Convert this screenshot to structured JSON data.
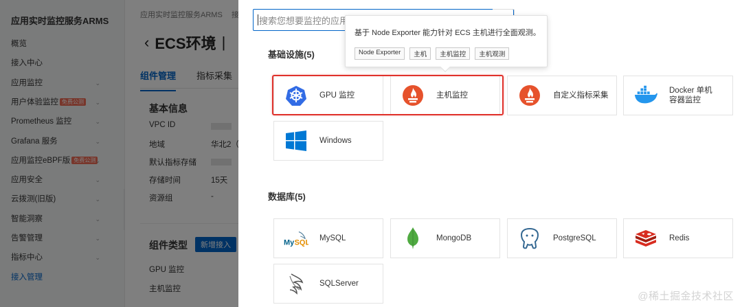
{
  "sidebar": {
    "title": "应用实时监控服务ARMS",
    "items": [
      {
        "label": "概览",
        "badge": "",
        "chevron": false,
        "active": false
      },
      {
        "label": "接入中心",
        "badge": "",
        "chevron": false,
        "active": false
      },
      {
        "label": "应用监控",
        "badge": "",
        "chevron": true,
        "active": false
      },
      {
        "label": "用户体验监控",
        "badge": "免费公测",
        "chevron": true,
        "active": false
      },
      {
        "label": "Prometheus 监控",
        "badge": "",
        "chevron": true,
        "active": false
      },
      {
        "label": "Grafana 服务",
        "badge": "",
        "chevron": true,
        "active": false
      },
      {
        "label": "应用监控eBPF版",
        "badge": "免费公测",
        "chevron": true,
        "active": false
      },
      {
        "label": "应用安全",
        "badge": "",
        "chevron": true,
        "active": false
      },
      {
        "label": "云拨测(旧版)",
        "badge": "",
        "chevron": true,
        "active": false
      },
      {
        "label": "智能洞察",
        "badge": "",
        "chevron": true,
        "active": false
      },
      {
        "label": "告警管理",
        "badge": "",
        "chevron": true,
        "active": false
      },
      {
        "label": "指标中心",
        "badge": "",
        "chevron": true,
        "active": false
      },
      {
        "label": "接入管理",
        "badge": "",
        "chevron": false,
        "active": true
      }
    ]
  },
  "main": {
    "breadcrumb": "应用实时监控服务ARMS",
    "breadcrumb_next": "接",
    "page_title": "ECS环境",
    "tabs": [
      "组件管理",
      "指标采集"
    ],
    "basic_info_title": "基本信息",
    "info_rows": [
      {
        "key": "VPC ID",
        "value": ""
      },
      {
        "key": "地域",
        "value": "华北2（"
      },
      {
        "key": "默认指标存储",
        "value": ""
      },
      {
        "key": "存储时间",
        "value": "15天"
      },
      {
        "key": "资源组",
        "value": "-"
      }
    ],
    "component_type_title": "组件类型",
    "add_button": "新增接入",
    "components": [
      "GPU 监控",
      "主机监控"
    ]
  },
  "drawer": {
    "search_placeholder": "搜索您想要监控的应用",
    "tooltip": {
      "text": "基于 Node Exporter 能力针对 ECS 主机进行全面观测。",
      "tags": [
        "Node Exporter",
        "主机",
        "主机监控",
        "主机观测"
      ]
    },
    "groups": [
      {
        "title": "基础设施(5)",
        "cards": [
          {
            "label": "GPU 监控",
            "icon": "kubernetes-icon"
          },
          {
            "label": "主机监控",
            "icon": "prometheus-icon"
          },
          {
            "label": "自定义指标采集",
            "icon": "prometheus-icon"
          },
          {
            "label": "Docker 单机\n容器监控",
            "icon": "docker-icon"
          },
          {
            "label": "Windows",
            "icon": "windows-icon"
          }
        ]
      },
      {
        "title": "数据库(5)",
        "cards": [
          {
            "label": "MySQL",
            "icon": "mysql-icon"
          },
          {
            "label": "MongoDB",
            "icon": "mongodb-icon"
          },
          {
            "label": "PostgreSQL",
            "icon": "postgresql-icon"
          },
          {
            "label": "Redis",
            "icon": "redis-icon"
          },
          {
            "label": "SQLServer",
            "icon": "sqlserver-icon"
          }
        ]
      }
    ]
  },
  "watermark": "@稀土掘金技术社区",
  "colors": {
    "accent": "#0064c8",
    "highlight": "#e0312b",
    "prometheus": "#e6522c",
    "kubernetes": "#326ce5",
    "docker": "#2496ed",
    "windows": "#0078d4",
    "redis": "#d82c20",
    "mongodb": "#4faa41",
    "postgres": "#336791"
  }
}
